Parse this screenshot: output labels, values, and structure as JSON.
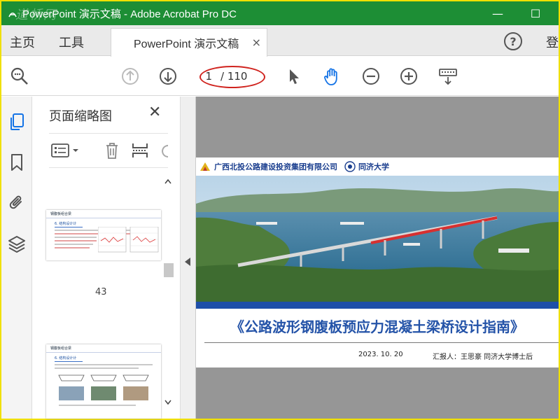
{
  "titlebar": {
    "title": "PowerPoint 演示文稿 - Adobe Acrobat Pro DC",
    "watermark": "道桥网",
    "minimize_glyph": "—",
    "maximize_glyph": "☐"
  },
  "menu": {
    "home": "主页",
    "tools": "工具",
    "tab_label": "PowerPoint 演示文稿",
    "tab_close": "×",
    "help": "?",
    "login": "登"
  },
  "toolbar": {
    "current_page": "1",
    "total_pages": "/ 110",
    "icons": [
      "search-zoom-icon",
      "previous-page-icon",
      "next-page-icon",
      "select-cursor-icon",
      "hand-tool-icon",
      "zoom-out-icon",
      "zoom-in-icon",
      "keyboard-scroll-icon"
    ]
  },
  "sidebar": {
    "panel_title": "页面缩略图",
    "panel_close": "✕",
    "rail_icons": [
      "page-thumbnails-icon",
      "bookmark-icon",
      "attachment-icon",
      "layers-icon"
    ],
    "thumbnails": [
      {
        "page_number": "43",
        "section_title": "6. 结构设计计",
        "header": "钢腹板组合梁"
      },
      {
        "page_number": "",
        "section_title": "6. 结构设计计",
        "header": "钢腹板组合梁"
      }
    ]
  },
  "slide": {
    "org_left": "广西北投公路建设投资集团有限公司",
    "org_right": "同济大学",
    "title": "《公路波形钢腹板预应力混凝土梁桥设计指南》",
    "date": "2023. 10. 20",
    "reporter": "汇报人：王思豪  同济大学博士后"
  },
  "colors": {
    "titlebar": "#1d8e35",
    "accent_blue": "#2453a8",
    "annotation_red": "#d0231e",
    "hand_tool_blue": "#1473e6"
  }
}
